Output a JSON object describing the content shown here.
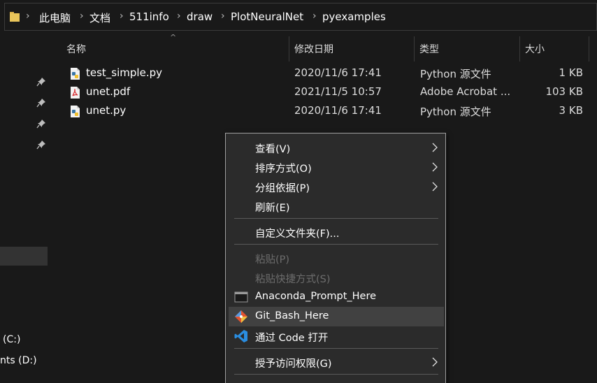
{
  "breadcrumb": {
    "items": [
      "此电脑",
      "文档",
      "511info",
      "draw",
      "PlotNeuralNet",
      "pyexamples"
    ]
  },
  "columns": {
    "name": "名称",
    "modified": "修改日期",
    "type": "类型",
    "size": "大小"
  },
  "files": [
    {
      "name": "test_simple.py",
      "modified": "2020/11/6 17:41",
      "type": "Python 源文件",
      "size": "1 KB",
      "icon": "python-file-icon"
    },
    {
      "name": "unet.pdf",
      "modified": "2021/11/5 10:57",
      "type": "Adobe Acrobat ...",
      "size": "103 KB",
      "icon": "pdf-file-icon"
    },
    {
      "name": "unet.py",
      "modified": "2020/11/6 17:41",
      "type": "Python 源文件",
      "size": "3 KB",
      "icon": "python-file-icon"
    }
  ],
  "nav": {
    "drive_c": "(C:)",
    "drive_d": "nts (D:)"
  },
  "context_menu": {
    "view": "查看(V)",
    "sort": "排序方式(O)",
    "group": "分组依据(P)",
    "refresh": "刷新(E)",
    "customize": "自定义文件夹(F)...",
    "paste": "粘贴(P)",
    "paste_shortcut": "粘贴快捷方式(S)",
    "anaconda": "Anaconda_Prompt_Here",
    "git_bash": "Git_Bash_Here",
    "vscode": "通过 Code 打开",
    "access": "授予访问权限(G)"
  },
  "colors": {
    "background": "#191919",
    "menu_background": "#2b2b2b",
    "menu_hover": "#414141",
    "disabled_text": "#6d6d6d",
    "folder": "#e8c45a",
    "vscode_blue": "#2a8de0",
    "git_orange": "#e4532f"
  }
}
